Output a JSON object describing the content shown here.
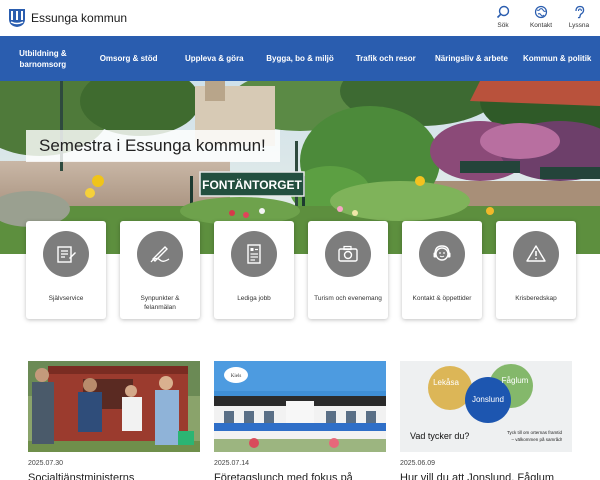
{
  "site": {
    "logo_text": "Essunga kommun",
    "brand_color": "#2a5daf"
  },
  "tools": [
    {
      "label": "Sök",
      "icon": "search-icon"
    },
    {
      "label": "Kontakt",
      "icon": "globe-icon"
    },
    {
      "label": "Lyssna",
      "icon": "ear-icon"
    }
  ],
  "nav": [
    "Utbildning & barnomsorg",
    "Omsorg & stöd",
    "Uppleva & göra",
    "Bygga, bo & miljö",
    "Trafik och resor",
    "Näringsliv & arbete",
    "Kommun & politik"
  ],
  "hero": {
    "title": "Semestra i Essunga kommun!",
    "sign_text": "FONTÄNTORGET"
  },
  "quick_links": [
    {
      "label": "Självservice",
      "icon": "form-icon"
    },
    {
      "label": "Synpunkter & felanmälan",
      "icon": "pencil-icon"
    },
    {
      "label": "Lediga jobb",
      "icon": "document-icon"
    },
    {
      "label": "Turism och evenemang",
      "icon": "camera-icon"
    },
    {
      "label": "Kontakt & öppettider",
      "icon": "headset-icon"
    },
    {
      "label": "Krisberedskap",
      "icon": "warning-icon"
    }
  ],
  "news": [
    {
      "date": "2025.07.30",
      "title": "Socialtjänstministerns"
    },
    {
      "date": "2025.07.14",
      "title": "Företagslunch med fokus på"
    },
    {
      "date": "2025.06.09",
      "title": "Hur vill du att Jonslund, Fåglum"
    }
  ],
  "news3_image": {
    "circle_1": "Lekåsa",
    "circle_2": "Fåglum",
    "circle_3": "Jonslund",
    "question": "Vad tycker du?",
    "note_1": "Tyck till om orternas framtid",
    "note_2": "– välkommen på samråd!"
  }
}
